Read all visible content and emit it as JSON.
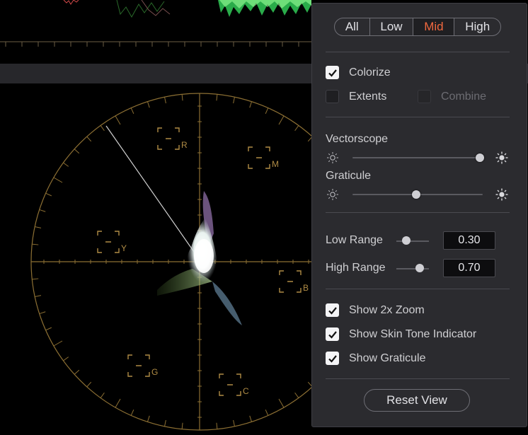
{
  "scope": {
    "target_labels": [
      "R",
      "M",
      "Y",
      "B",
      "G",
      "C"
    ]
  },
  "panel": {
    "modes": [
      "All",
      "Low",
      "Mid",
      "High"
    ],
    "active_mode": "Mid",
    "colorize": {
      "label": "Colorize",
      "checked": true
    },
    "extents": {
      "label": "Extents",
      "checked": false
    },
    "combine": {
      "label": "Combine",
      "checked": false,
      "enabled": false
    },
    "vectorscope": {
      "label": "Vectorscope",
      "level": 0.98
    },
    "graticule": {
      "label": "Graticule",
      "level": 0.49
    },
    "low_range": {
      "label": "Low Range",
      "value": "0.30"
    },
    "high_range": {
      "label": "High Range",
      "value": "0.70"
    },
    "show_zoom": {
      "label": "Show 2x Zoom",
      "checked": true
    },
    "show_skin_tone": {
      "label": "Show Skin Tone Indicator",
      "checked": true
    },
    "show_graticule": {
      "label": "Show Graticule",
      "checked": true
    },
    "reset_label": "Reset View",
    "accent_color": "#f0683f"
  }
}
